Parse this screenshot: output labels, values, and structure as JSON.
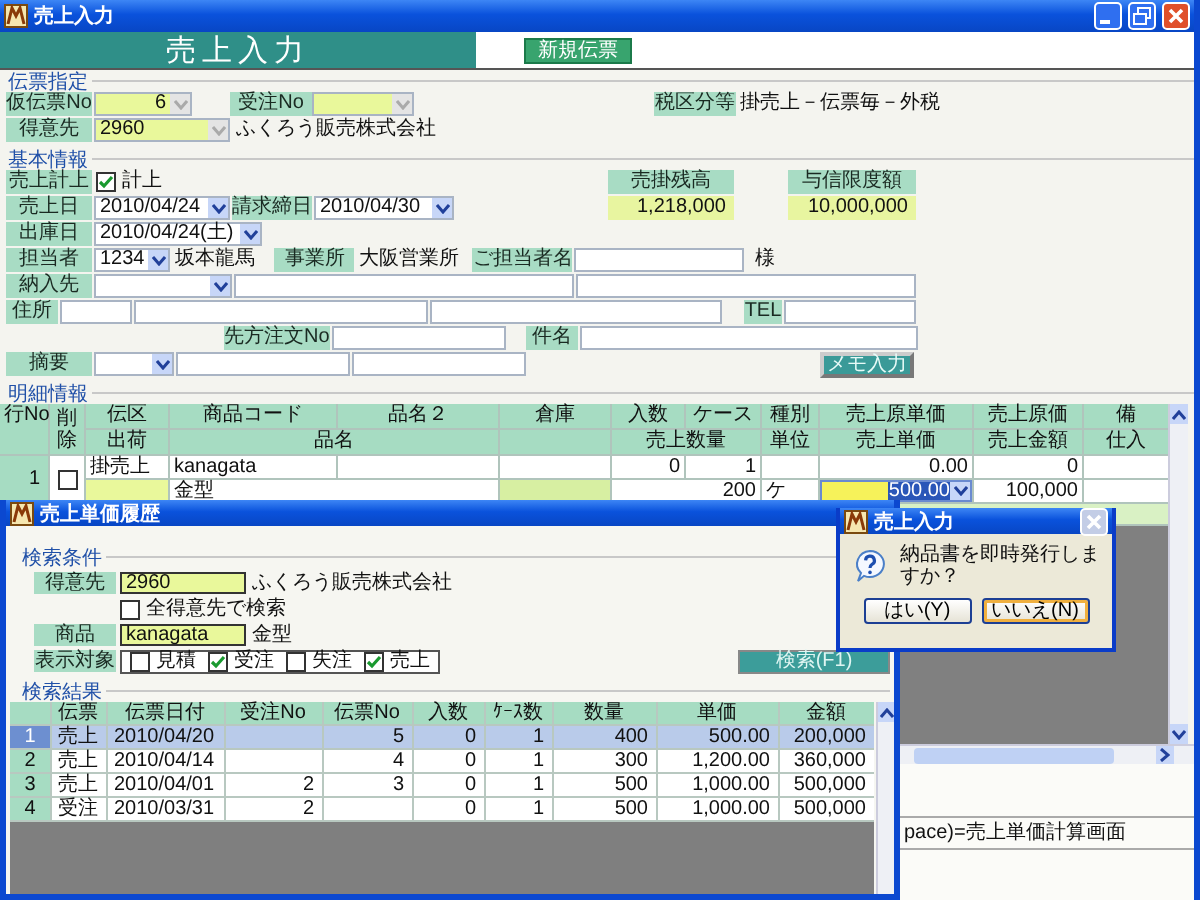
{
  "main_window": {
    "title": "売上入力",
    "header": "売上入力",
    "new_slip_button": "新規伝票",
    "sections": [
      {
        "title": "伝票指定",
        "rows": [
          {
            "items": [
              {
                "kind": "label",
                "text": "仮伝票No"
              },
              {
                "kind": "combo",
                "value": "6",
                "highlighted": true,
                "disabled": true
              },
              {
                "kind": "label",
                "text": "受注No"
              },
              {
                "kind": "combo",
                "highlighted": true,
                "disabled": true
              },
              {
                "kind": "label",
                "text": "税区分等"
              },
              {
                "kind": "text",
                "text": "掛売上－伝票毎－外税"
              }
            ]
          },
          {
            "items": [
              {
                "kind": "label",
                "text": "得意先"
              },
              {
                "kind": "combo",
                "value": "2960",
                "highlighted": true,
                "disabled": true
              },
              {
                "kind": "text",
                "text": "ふくろう販売株式会社"
              }
            ]
          }
        ]
      },
      {
        "title": "基本情報",
        "rows": [
          {
            "items": [
              {
                "kind": "label",
                "text": "売上計上"
              },
              {
                "kind": "check",
                "text": "計上",
                "checked": true
              },
              {
                "kind": "label",
                "text": "売掛残高"
              },
              {
                "kind": "label",
                "text": "与信限度額"
              }
            ]
          },
          {
            "items": [
              {
                "kind": "label",
                "text": "売上日"
              },
              {
                "kind": "combo",
                "value": "2010/04/24",
                "highlighted": false,
                "disabled": false
              },
              {
                "kind": "label",
                "text": "請求締日"
              },
              {
                "kind": "combo",
                "value": "2010/04/30",
                "highlighted": false,
                "disabled": false
              },
              {
                "kind": "value",
                "text": "1,218,000"
              },
              {
                "kind": "value",
                "text": "10,000,000"
              }
            ]
          },
          {
            "items": [
              {
                "kind": "label",
                "text": "出庫日"
              },
              {
                "kind": "combo",
                "value": "2010/04/24(土)",
                "highlighted": false,
                "disabled": false
              }
            ]
          },
          {
            "items": [
              {
                "kind": "label",
                "text": "担当者"
              },
              {
                "kind": "combo",
                "value": "1234",
                "highlighted": false,
                "disabled": false
              },
              {
                "kind": "text",
                "text": "坂本龍馬"
              },
              {
                "kind": "label",
                "text": "事業所"
              },
              {
                "kind": "text",
                "text": "大阪営業所"
              },
              {
                "kind": "label",
                "text": "ご担当者名"
              },
              {
                "kind": "field"
              },
              {
                "kind": "text",
                "text": "様"
              }
            ]
          },
          {
            "items": [
              {
                "kind": "label",
                "text": "納入先"
              },
              {
                "kind": "combo",
                "highlighted": false,
                "disabled": false
              },
              {
                "kind": "field"
              },
              {
                "kind": "field"
              }
            ]
          },
          {
            "items": [
              {
                "kind": "label",
                "text": "住所"
              },
              {
                "kind": "field"
              },
              {
                "kind": "field"
              },
              {
                "kind": "field"
              },
              {
                "kind": "label",
                "text": "TEL"
              },
              {
                "kind": "field"
              }
            ]
          },
          {
            "items": [
              {
                "kind": "label",
                "text": "先方注文No"
              },
              {
                "kind": "field"
              },
              {
                "kind": "label",
                "text": "件名"
              },
              {
                "kind": "field"
              }
            ]
          },
          {
            "items": [
              {
                "kind": "label",
                "text": "摘要"
              },
              {
                "kind": "combo",
                "highlighted": false,
                "disabled": false
              },
              {
                "kind": "field"
              },
              {
                "kind": "field"
              },
              {
                "kind": "button",
                "text": "メモ入力"
              }
            ]
          }
        ]
      }
    ],
    "detail": {
      "title": "明細情報",
      "header_top": [
        "行No",
        "削除",
        "伝区",
        "商品コード",
        "品名２",
        "倉庫",
        "入数",
        "ケース",
        "種別",
        "売上原単価",
        "売上原価",
        "備"
      ],
      "header_bottom": [
        "出荷",
        "品名",
        "売上数量",
        "単位",
        "売上単価",
        "売上金額",
        "仕入"
      ],
      "rows": [
        {
          "row_no": "1",
          "deleted": false,
          "sales_unit_price_editing": true,
          "top": {
            "slip_type": "掛売上",
            "product_code": "kanagata",
            "quantity_per_case": "0",
            "cases": "1",
            "cost_unit_price": "0.00",
            "cost": "0"
          },
          "bottom": {
            "product_name": "金型",
            "sales_quantity": "200",
            "unit": "ケ",
            "sales_unit_price": "500.00",
            "sales_amount": "100,000"
          }
        }
      ]
    },
    "status": "pace)=売上単価計算画面"
  },
  "history_window": {
    "title": "売上単価履歴",
    "conditions_title": "検索条件",
    "customer_label": "得意先",
    "customer_code": "2960",
    "customer_name": "ふくろう販売株式会社",
    "all_customers": {
      "label": "全得意先で検索",
      "checked": false
    },
    "product_label": "商品",
    "product_code": "kanagata",
    "product_name": "金型",
    "filter_label": "表示対象",
    "filters": [
      {
        "label": "見積",
        "checked": false
      },
      {
        "label": "受注",
        "checked": true
      },
      {
        "label": "失注",
        "checked": false
      },
      {
        "label": "売上",
        "checked": true
      }
    ],
    "search_button": "検索(F1)",
    "results_title": "検索結果",
    "columns": [
      "伝票",
      "伝票日付",
      "受注No",
      "伝票No",
      "入数",
      "ｹｰｽ数",
      "数量",
      "単価",
      "金額"
    ],
    "rows": [
      {
        "row_no": "1",
        "selected": true,
        "cells": [
          "売上",
          "2010/04/20",
          null,
          "5",
          "0",
          "1",
          "400",
          "500.00",
          "200,000"
        ]
      },
      {
        "row_no": "2",
        "selected": false,
        "cells": [
          "売上",
          "2010/04/14",
          null,
          "4",
          "0",
          "1",
          "300",
          "1,200.00",
          "360,000"
        ]
      },
      {
        "row_no": "3",
        "selected": false,
        "cells": [
          "売上",
          "2010/04/01",
          "2",
          "3",
          "0",
          "1",
          "500",
          "1,000.00",
          "500,000"
        ]
      },
      {
        "row_no": "4",
        "selected": false,
        "cells": [
          "受注",
          "2010/03/31",
          "2",
          null,
          "0",
          "1",
          "500",
          "1,000.00",
          "500,000"
        ]
      }
    ]
  },
  "dialog": {
    "title": "売上入力",
    "message": "納品書を即時発行しますか？",
    "buttons": [
      {
        "label": "はい(Y)",
        "focused": false
      },
      {
        "label": "いいえ(N)",
        "focused": true
      }
    ]
  }
}
